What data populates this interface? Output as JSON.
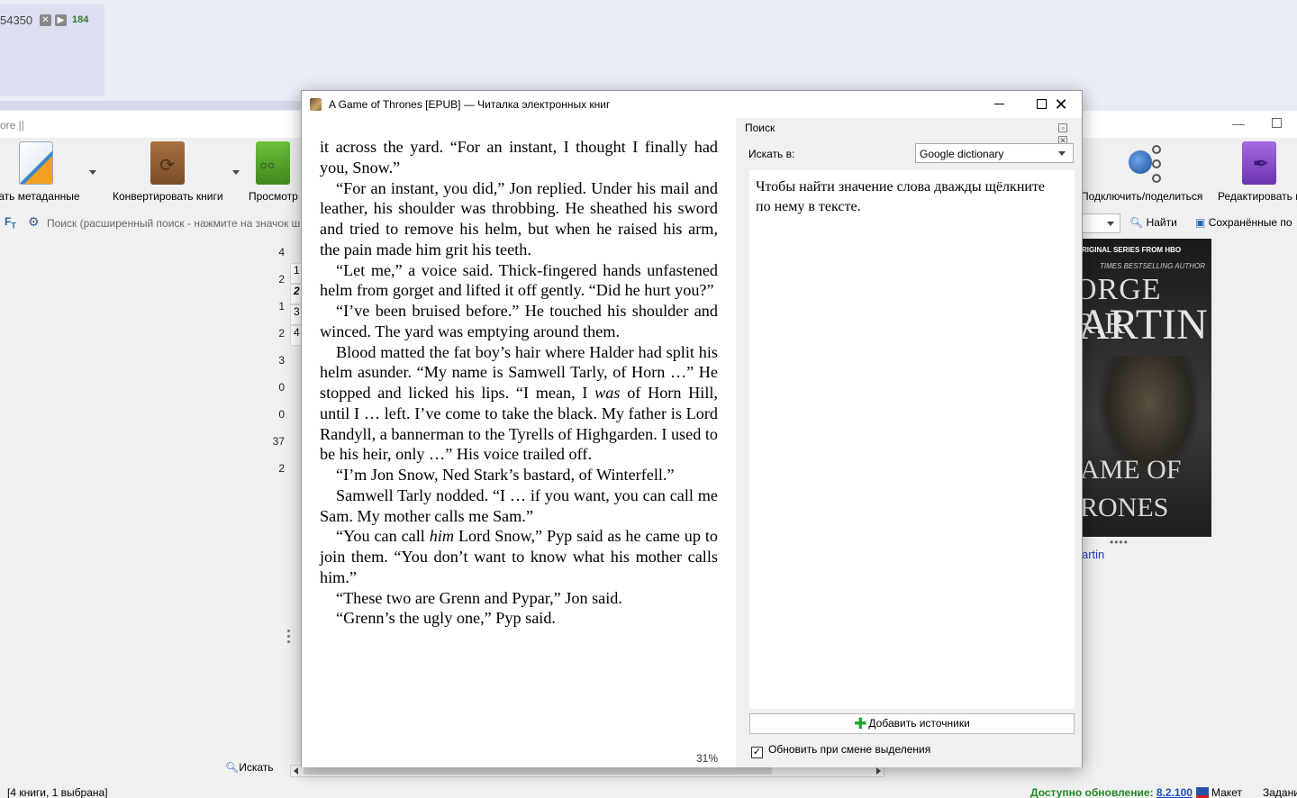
{
  "taskbar": {
    "item_number": "54350",
    "close_icon": "close-icon",
    "play_icon": "play-icon",
    "count": "184"
  },
  "library": {
    "title_fragment": "ore ||",
    "toolbar": [
      {
        "label": "вать метаданные",
        "icon": "edit-metadata-icon",
        "color": "#3a86c8"
      },
      {
        "label": "Конвертировать книги",
        "icon": "convert-books-icon",
        "color": "#8a5a32"
      },
      {
        "label": "Просмотр",
        "icon": "view-book-icon",
        "color": "#4a9a2a"
      },
      {
        "label": "Подключить/поделиться",
        "icon": "connect-share-icon",
        "color": "#2a66b4"
      },
      {
        "label": "Редактировать к",
        "icon": "edit-book-icon",
        "color": "#8a4ac8"
      }
    ],
    "search": {
      "placeholder": "Поиск (расширенный поиск - нажмите на значок ш",
      "find_label": "Найти",
      "saved_label": "Сохранённые по"
    },
    "rows": [
      {
        "num": "4",
        "col2": ""
      },
      {
        "num": "2",
        "col2": "1"
      },
      {
        "num": "1",
        "col2": "2"
      },
      {
        "num": "2",
        "col2": "3"
      },
      {
        "num": "3",
        "col2": "4"
      },
      {
        "num": "0",
        "col2": ""
      },
      {
        "num": "0",
        "col2": ""
      },
      {
        "num": "37",
        "col2": ""
      },
      {
        "num": "2",
        "col2": ""
      }
    ],
    "find_button": "Искать",
    "cover": {
      "band": "RIGINAL SERIES FROM",
      "band_logo": "HBO",
      "sub": "TIMES BESTSELLING AUTHOR",
      "author_line1": "ORGE R.R.",
      "author_line2": "ARTIN",
      "title_line1": "AME OF",
      "title_line2": "RONES"
    },
    "cover_author": "artin",
    "status": {
      "books": "[4 книги, 1 выбрана]",
      "update_prefix": "Доступно обновление:",
      "update_version": "8.2.100",
      "layout_label": "Макет",
      "jobs_label": "Задани"
    }
  },
  "viewer": {
    "title": "A Game of Thrones [EPUB] — Читалка электронных книг",
    "paragraphs": [
      {
        "parts": [
          "it across the yard. “For an instant, I thought I finally had you, Snow.”"
        ],
        "first": true
      },
      {
        "parts": [
          "“For an instant, you did,” Jon replied. Under his mail and leather, his shoulder was throbbing. He sheathed his sword and tried to remove his helm, but when he raised his arm, the pain made him grit his teeth."
        ]
      },
      {
        "parts": [
          "“Let me,” a voice said. Thick-fingered hands unfastened helm from gorget and lifted it off gently. “Did he hurt you?”"
        ]
      },
      {
        "parts": [
          "“I’ve been bruised before.” He touched his shoulder and winced. The yard was emptying around them."
        ]
      },
      {
        "parts": [
          "Blood matted the fat boy’s hair where Halder had split his helm asunder. “My name is Samwell Tarly, of Horn …” He stopped and licked his lips. “I mean, I ",
          "was",
          " of Horn Hill, until I … left. I’ve come to take the black. My father is Lord Randyll, a bannerman to the Tyrells of Highgarden. I used to be his heir, only …” His voice trailed off."
        ]
      },
      {
        "parts": [
          "“I’m Jon Snow, Ned Stark’s bastard, of Winterfell.”"
        ]
      },
      {
        "parts": [
          "Samwell Tarly nodded. “I … if you want, you can call me Sam. My mother calls me Sam.”"
        ]
      },
      {
        "parts": [
          "“You can call ",
          "him",
          " Lord Snow,” Pyp said as he came up to join them. “You don’t want to know what his mother calls him.”"
        ]
      },
      {
        "parts": [
          "“These two are Grenn and Pypar,” Jon said."
        ]
      },
      {
        "parts": [
          "“Grenn’s the ugly one,” Pyp said."
        ]
      }
    ],
    "progress": "31%",
    "lookup": {
      "header": "Поиск",
      "search_in_label": "Искать в:",
      "source": "Google dictionary",
      "hint": "Чтобы найти значение слова дважды щёлкните по нему в тексте.",
      "add_sources": "Добавить источники",
      "refresh_label": "Обновить при смене выделения",
      "refresh_checked": true
    }
  }
}
